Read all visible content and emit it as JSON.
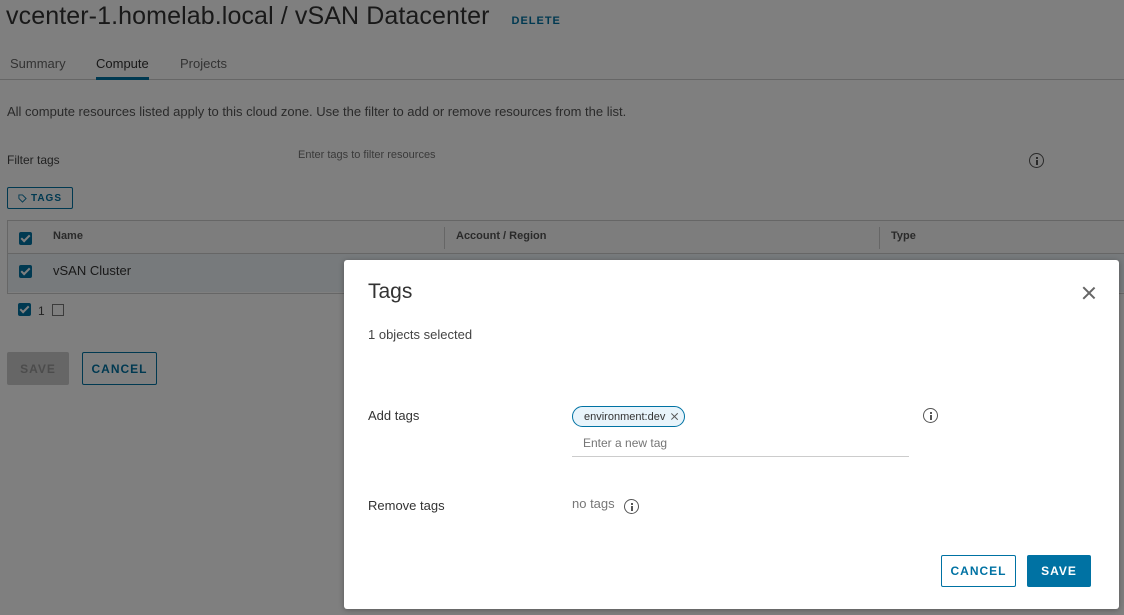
{
  "page": {
    "title": "vcenter-1.homelab.local / vSAN Datacenter",
    "delete_label": "DELETE",
    "tabs": [
      {
        "label": "Summary"
      },
      {
        "label": "Compute"
      },
      {
        "label": "Projects"
      }
    ],
    "active_tab": "Compute",
    "help_text": "All compute resources listed apply to this cloud zone. Use the filter to add or remove resources from the list.",
    "filter_label": "Filter tags",
    "filter_placeholder": "Enter tags to filter resources",
    "tags_button": "TAGS",
    "grid": {
      "columns": [
        "Name",
        "Account / Region",
        "Type"
      ],
      "rows": [
        {
          "name": "vSAN Cluster",
          "selected": true
        }
      ],
      "footer_count": "1"
    },
    "save_label": "SAVE",
    "cancel_label": "CANCEL"
  },
  "modal": {
    "title": "Tags",
    "selected_text": "1 objects selected",
    "add_tags_label": "Add tags",
    "tag_chips": [
      {
        "label": "environment:dev"
      }
    ],
    "new_tag_placeholder": "Enter a new tag",
    "remove_tags_label": "Remove tags",
    "no_tags_text": "no tags",
    "cancel_label": "CANCEL",
    "save_label": "SAVE"
  },
  "colors": {
    "accent": "#0072a3",
    "overlay": "rgba(0,0,0,0.5)"
  }
}
